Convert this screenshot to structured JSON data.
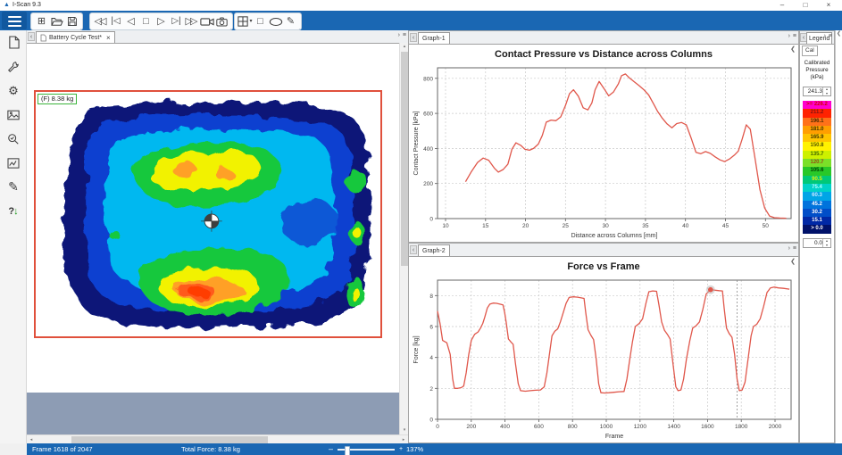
{
  "window": {
    "title": "I-Scan 9.3",
    "minimize": "–",
    "maximize": "□",
    "close": "×"
  },
  "colors": {
    "toolbar_blue": "#1a67b3",
    "statusbar_blue": "#1a67b3",
    "sensor_outline_red": "#e0503c",
    "force_label_border": "#3cb43c",
    "chart_line": "#e0574b",
    "canvas_overflow_gray": "#8d9cb4"
  },
  "toolbar": {
    "file_group": [
      "add-window",
      "open-file",
      "save-file"
    ],
    "playback_group": [
      "rewind",
      "first-frame",
      "prev-frame",
      "stop-frame",
      "play",
      "next-frame",
      "fast-forward",
      "record-movie",
      "snapshot"
    ],
    "draw_group": [
      "grid-view",
      "rectangle-tool",
      "ellipse-tool",
      "pencil-tool"
    ]
  },
  "sidebar": {
    "items": [
      "new-document",
      "tools-wrench",
      "settings-gear",
      "image-view",
      "zoom-inspect",
      "graph-view",
      "annotate-pencil",
      "help-update"
    ]
  },
  "tabs": {
    "main": "Battery Cycle Test*",
    "close": "×",
    "graph1": "Graph-1",
    "graph2": "Graph-2"
  },
  "heatmap": {
    "force_label": "(F) 8.38 kg"
  },
  "legend": {
    "tab": "Legend",
    "subtab": "Cal",
    "heading1": "Calibrated",
    "heading2": "Pressure (kPa)",
    "max": "241.3",
    "min": "0.0",
    "scale": [
      {
        "label": ">= 226.2",
        "color": "#ff00cd",
        "text": "#d40000"
      },
      {
        "label": "211.2",
        "color": "#ff2301",
        "text": "#7d1414"
      },
      {
        "label": "196.1",
        "color": "#ff7119",
        "text": "#4a2a00"
      },
      {
        "label": "181.0",
        "color": "#ff9e00",
        "text": "#403300"
      },
      {
        "label": "165.9",
        "color": "#ffc400",
        "text": "#403300"
      },
      {
        "label": "150.8",
        "color": "#fff200",
        "text": "#555500"
      },
      {
        "label": "135.7",
        "color": "#cdf000",
        "text": "#446600"
      },
      {
        "label": "120.7",
        "color": "#7be028",
        "text": "#9a4a14"
      },
      {
        "label": "105.6",
        "color": "#28c828",
        "text": "#004400"
      },
      {
        "label": "90.5",
        "color": "#00c878",
        "text": "#e8f000"
      },
      {
        "label": "75.4",
        "color": "#00d2c8",
        "text": "#b0ffff"
      },
      {
        "label": "60.3",
        "color": "#00a5e6",
        "text": "#c8e8ff"
      },
      {
        "label": "45.2",
        "color": "#0073dc",
        "text": "#ffffff"
      },
      {
        "label": "30.2",
        "color": "#004ec8",
        "text": "#ffffff"
      },
      {
        "label": "15.1",
        "color": "#0028a5",
        "text": "#ffffff"
      },
      {
        "label": "> 0.0",
        "color": "#001169",
        "text": "#ffffff"
      }
    ]
  },
  "status": {
    "frame": "Frame 1618 of 2047",
    "force": "Total Force: 8.38 kg",
    "zoom": "137%"
  },
  "chart_data": [
    {
      "type": "line",
      "title": "Contact Pressure vs Distance across Columns",
      "xlabel": "Distance across Columns [mm]",
      "ylabel": "Contact Pressure [kPa]",
      "xlim": [
        9,
        53.2
      ],
      "ylim": [
        0,
        860
      ],
      "xticks": [
        10,
        15,
        20,
        25,
        30,
        35,
        40,
        45,
        50
      ],
      "yticks": [
        0,
        200,
        400,
        600,
        800
      ],
      "grid": true,
      "color": "#e0574b",
      "x": [
        12.5,
        13.2,
        14,
        14.7,
        15.4,
        16.1,
        16.6,
        17.2,
        17.8,
        18.3,
        18.8,
        19.4,
        19.9,
        20.5,
        21,
        21.6,
        22.1,
        22.6,
        23.2,
        23.8,
        24.4,
        25,
        25.5,
        26,
        26.6,
        27.2,
        27.8,
        28.3,
        28.7,
        29.2,
        29.8,
        30.4,
        31,
        31.6,
        32,
        32.5,
        33,
        33.6,
        34.2,
        34.8,
        35.4,
        36,
        36.5,
        37.1,
        37.7,
        38.3,
        38.9,
        39.5,
        40.1,
        40.7,
        41.3,
        41.9,
        42.5,
        43.1,
        43.7,
        44.3,
        44.9,
        45.5,
        46.1,
        46.6,
        47.1,
        47.6,
        48.1,
        48.7,
        49.3,
        49.9,
        50.5,
        51.1,
        51.8,
        52.6
      ],
      "y": [
        210,
        265,
        320,
        345,
        333,
        288,
        265,
        280,
        310,
        395,
        432,
        418,
        396,
        390,
        400,
        425,
        475,
        550,
        562,
        558,
        580,
        645,
        712,
        735,
        698,
        632,
        620,
        660,
        735,
        782,
        742,
        700,
        722,
        768,
        815,
        825,
        802,
        780,
        758,
        735,
        705,
        655,
        612,
        572,
        540,
        518,
        542,
        548,
        535,
        460,
        378,
        370,
        382,
        372,
        352,
        335,
        325,
        340,
        362,
        385,
        455,
        535,
        510,
        340,
        165,
        60,
        15,
        5,
        3,
        2
      ]
    },
    {
      "type": "line",
      "title": "Force vs Frame",
      "xlabel": "Frame",
      "ylabel": "Force [kg]",
      "xlim": [
        0,
        2095
      ],
      "ylim": [
        0,
        9
      ],
      "xticks": [
        0,
        200,
        400,
        600,
        800,
        1000,
        1200,
        1400,
        1600,
        1800,
        2000
      ],
      "yticks": [
        0,
        2,
        4,
        6,
        8
      ],
      "grid": true,
      "color": "#e0574b",
      "cursor_x": 1775,
      "marker": {
        "x": 1618,
        "y": 8.38
      },
      "x": [
        0,
        15,
        30,
        55,
        75,
        90,
        100,
        120,
        140,
        155,
        170,
        185,
        200,
        220,
        240,
        255,
        268,
        280,
        295,
        310,
        330,
        350,
        370,
        388,
        398,
        408,
        420,
        435,
        448,
        462,
        478,
        492,
        520,
        550,
        580,
        610,
        632,
        648,
        662,
        678,
        695,
        712,
        728,
        745,
        762,
        780,
        805,
        830,
        852,
        868,
        878,
        892,
        908,
        925,
        940,
        955,
        968,
        990,
        1015,
        1045,
        1075,
        1105,
        1122,
        1138,
        1155,
        1172,
        1195,
        1215,
        1235,
        1252,
        1275,
        1298,
        1312,
        1328,
        1345,
        1362,
        1378,
        1395,
        1412,
        1425,
        1442,
        1458,
        1475,
        1495,
        1512,
        1532,
        1552,
        1572,
        1592,
        1618,
        1645,
        1668,
        1688,
        1698,
        1712,
        1728,
        1745,
        1760,
        1775,
        1788,
        1805,
        1822,
        1840,
        1858,
        1872,
        1892,
        1912,
        1932,
        1952,
        1972,
        1995,
        2020,
        2050,
        2085
      ],
      "y": [
        7.0,
        6.2,
        5.1,
        4.95,
        4.2,
        2.6,
        2.0,
        2.0,
        2.05,
        2.15,
        3.0,
        4.2,
        5.1,
        5.5,
        5.65,
        5.9,
        6.2,
        6.6,
        7.2,
        7.45,
        7.52,
        7.5,
        7.45,
        7.4,
        6.9,
        6.2,
        5.2,
        5.0,
        4.85,
        3.6,
        2.3,
        1.85,
        1.82,
        1.85,
        1.88,
        1.9,
        2.1,
        3.0,
        4.1,
        5.4,
        5.7,
        5.85,
        6.3,
        6.9,
        7.5,
        7.88,
        7.92,
        7.9,
        7.85,
        7.82,
        6.9,
        5.8,
        5.45,
        5.15,
        3.9,
        2.3,
        1.72,
        1.7,
        1.72,
        1.75,
        1.78,
        1.8,
        2.6,
        3.8,
        5.0,
        6.0,
        6.2,
        6.5,
        7.5,
        8.25,
        8.3,
        8.28,
        7.4,
        6.3,
        5.75,
        5.5,
        5.2,
        3.6,
        2.1,
        1.85,
        1.9,
        2.6,
        3.9,
        5.1,
        5.9,
        6.05,
        6.3,
        7.1,
        8.1,
        8.38,
        8.35,
        8.32,
        8.3,
        7.2,
        5.9,
        5.55,
        5.3,
        4.2,
        2.6,
        1.85,
        1.9,
        2.4,
        3.9,
        5.4,
        6.0,
        6.15,
        6.5,
        7.3,
        8.2,
        8.5,
        8.55,
        8.5,
        8.47,
        8.42
      ]
    }
  ]
}
